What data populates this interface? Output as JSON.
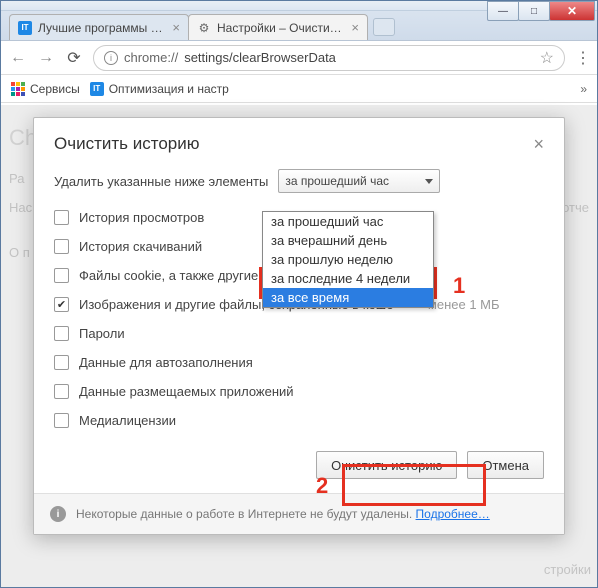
{
  "window": {
    "minimize": "—",
    "maximize": "□",
    "close": "✕"
  },
  "tabs": [
    {
      "favicon": "IT",
      "label": "Лучшие программы для…",
      "active": false
    },
    {
      "favicon": "gear",
      "label": "Настройки – Очистить и…",
      "active": true
    }
  ],
  "toolbar": {
    "url_scheme": "chrome://",
    "url_path": "settings/clearBrowserData"
  },
  "bookmarks": {
    "apps_label": "Сервисы",
    "item1": "Оптимизация и настр"
  },
  "page_bg": {
    "heading_fragment": "Ch",
    "line1": "Ра",
    "line2": "Нас",
    "right": "и отче",
    "line3": "О п",
    "bottom": "стройки"
  },
  "dialog": {
    "title": "Очистить историю",
    "row1_label": "Удалить указанные ниже элементы",
    "select_value": "за прошедший час",
    "options": [
      "за прошедший час",
      "за вчерашний день",
      "за прошлую неделю",
      "за последние 4 недели",
      "за все время"
    ],
    "checks": [
      {
        "label": "История просмотров",
        "checked": false
      },
      {
        "label": "История скачиваний",
        "checked": false
      },
      {
        "label": "Файлы cookie, а также другие да",
        "checked": false
      },
      {
        "label": "Изображения и другие файлы, сохраненные в кеше",
        "checked": true,
        "note": "– менее 1 МБ"
      },
      {
        "label": "Пароли",
        "checked": false
      },
      {
        "label": "Данные для автозаполнения",
        "checked": false
      },
      {
        "label": "Данные размещаемых приложений",
        "checked": false
      },
      {
        "label": "Медиалицензии",
        "checked": false
      }
    ],
    "primary_btn": "Очистить историю",
    "cancel_btn": "Отмена",
    "info_text": "Некоторые данные о работе в Интернете не будут удалены. ",
    "info_link": "Подробнее…"
  },
  "annotations": {
    "n1": "1",
    "n2": "2"
  }
}
